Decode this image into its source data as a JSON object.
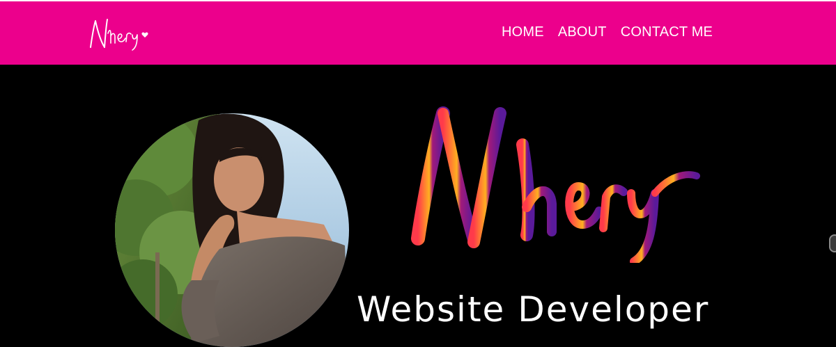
{
  "navbar": {
    "logo_text": "Nhery",
    "links": [
      "HOME",
      "ABOUT",
      "CONTACT ME"
    ]
  },
  "hero": {
    "name": "Nhery",
    "role": "Website Developer",
    "portrait_alt": "Portrait photo"
  },
  "colors": {
    "brand_pink": "#ec008c",
    "background": "#000000",
    "gradient_start": "#ff3a4a",
    "gradient_mid": "#ffb020",
    "gradient_end": "#5a1a9a"
  },
  "icons": {
    "logo_heart": "heart-icon",
    "scroll": "scroll-handle"
  }
}
